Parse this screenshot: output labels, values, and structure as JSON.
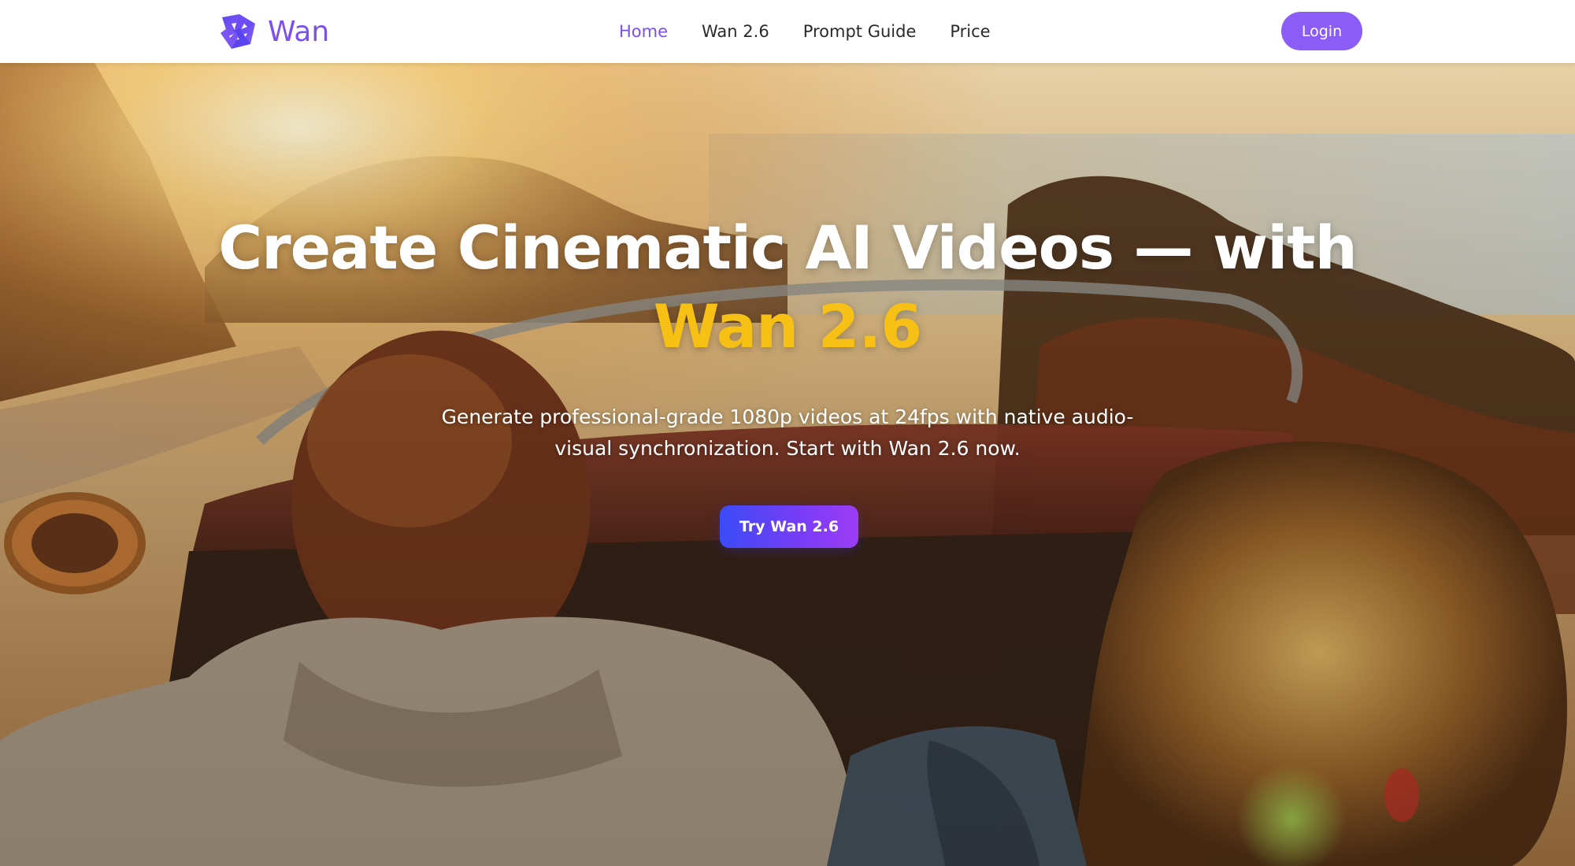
{
  "brand": {
    "name": "Wan",
    "color": "#7b4ff0"
  },
  "nav": {
    "items": [
      {
        "label": "Home",
        "active": true
      },
      {
        "label": "Wan 2.6",
        "active": false
      },
      {
        "label": "Prompt Guide",
        "active": false
      },
      {
        "label": "Price",
        "active": false
      }
    ],
    "login_label": "Login"
  },
  "hero": {
    "title_line1": "Create Cinematic AI Videos — with",
    "title_line2": "Wan 2.6",
    "title_highlight_color": "#f6c014",
    "subtitle": "Generate professional-grade 1080p videos at 24fps with native audio-visual synchronization. Start with Wan 2.6 now.",
    "cta_label": "Try Wan 2.6",
    "background": "sunset-convertible-road-scene"
  },
  "colors": {
    "accent": "#8b5cf6",
    "cta_gradient_start": "#3b4bf7",
    "cta_gradient_end": "#9d3df5"
  }
}
